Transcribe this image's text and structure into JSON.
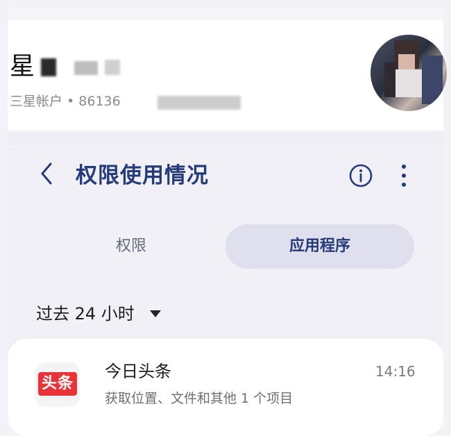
{
  "account": {
    "name": "星",
    "sub": "三星帐户 • 86136"
  },
  "header": {
    "title": "权限使用情况",
    "back_icon": "chevron-left-icon",
    "info_icon": "info-icon",
    "more_icon": "more-vert-icon"
  },
  "tabs": [
    {
      "label": "权限",
      "selected": false
    },
    {
      "label": "应用程序",
      "selected": true
    }
  ],
  "filter": {
    "label": "过去 24 小时"
  },
  "apps": [
    {
      "icon_text": "头条",
      "name": "今日头条",
      "desc": "获取位置、文件和其他 1 个项目",
      "time": "14:16"
    }
  ],
  "colors": {
    "accent": "#243a7a",
    "tab_selected_bg": "#dfdfed",
    "app_icon_red": "#e83339"
  }
}
